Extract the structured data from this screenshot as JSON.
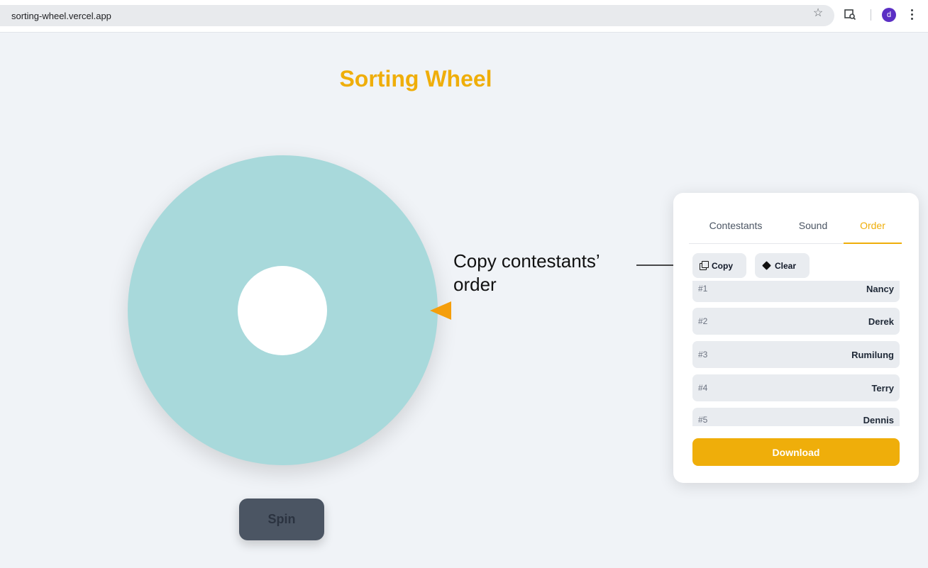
{
  "browser": {
    "url": "sorting-wheel.vercel.app",
    "profile_initial": "d",
    "icons": [
      "star-icon",
      "extension-icon",
      "kebab-menu-icon"
    ]
  },
  "app": {
    "title": "Sorting Wheel",
    "spin_label": "Spin",
    "colors": {
      "title": "#efae0a",
      "wheel": "#a8d9db",
      "pointer": "#f59e0b",
      "spin_button": "#4b5563",
      "download_button": "#efae0a",
      "background": "#f0f3f7"
    }
  },
  "annotation": {
    "line1": "Copy contestants’",
    "line2": "order"
  },
  "panel": {
    "tabs": [
      {
        "label": "Contestants",
        "active": false
      },
      {
        "label": "Sound",
        "active": false
      },
      {
        "label": "Order",
        "active": true
      }
    ],
    "copy_label": "Copy",
    "clear_label": "Clear",
    "order": [
      {
        "rank": "#1",
        "name": "Nancy"
      },
      {
        "rank": "#2",
        "name": "Derek"
      },
      {
        "rank": "#3",
        "name": "Rumilung"
      },
      {
        "rank": "#4",
        "name": "Terry"
      },
      {
        "rank": "#5",
        "name": "Dennis"
      }
    ],
    "download_label": "Download"
  }
}
